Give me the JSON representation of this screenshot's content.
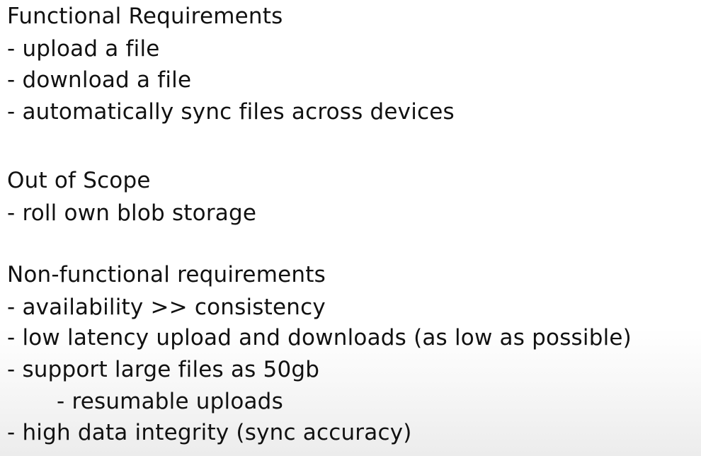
{
  "sections": [
    {
      "heading": "Functional Requirements",
      "items": [
        "- upload a file",
        "- download a file",
        "- automatically sync files across devices"
      ]
    },
    {
      "heading": "Out of Scope",
      "items": [
        "- roll own blob storage"
      ]
    },
    {
      "heading": "Non-functional requirements",
      "items": [
        "- availability >> consistency",
        "- low latency upload and downloads (as low as possible)",
        "- support large files as 50gb",
        "- resumable uploads",
        "- high data integrity (sync accuracy)"
      ]
    }
  ]
}
